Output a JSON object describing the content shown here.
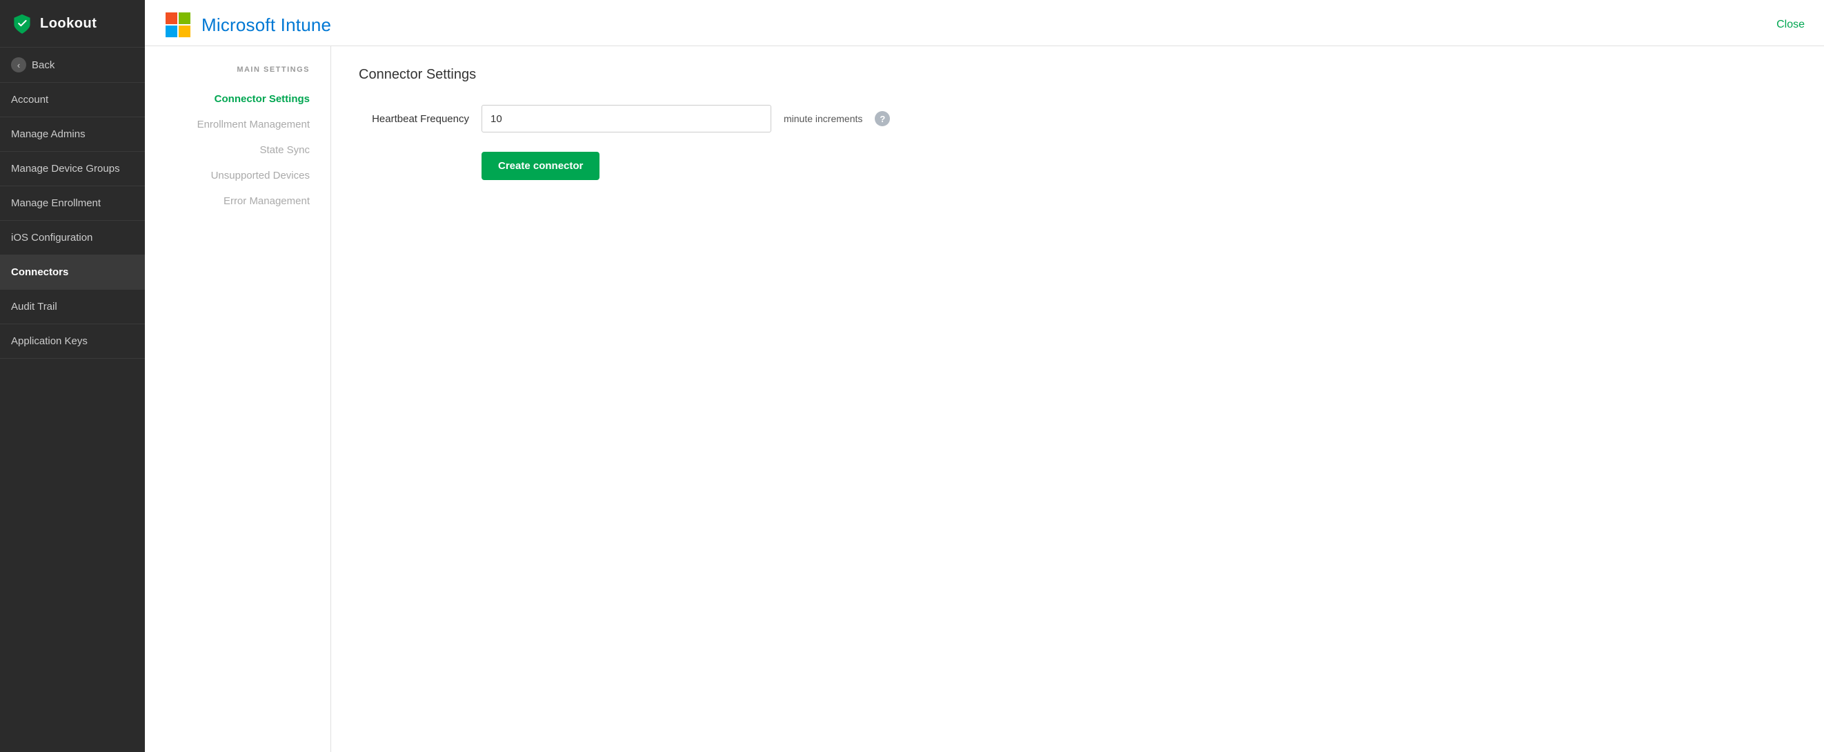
{
  "sidebar": {
    "logo_text": "Lookout",
    "back_label": "Back",
    "items": [
      {
        "id": "account",
        "label": "Account",
        "active": false
      },
      {
        "id": "manage-admins",
        "label": "Manage Admins",
        "active": false
      },
      {
        "id": "manage-device-groups",
        "label": "Manage Device Groups",
        "active": false
      },
      {
        "id": "manage-enrollment",
        "label": "Manage Enrollment",
        "active": false
      },
      {
        "id": "ios-configuration",
        "label": "iOS Configuration",
        "active": false
      },
      {
        "id": "connectors",
        "label": "Connectors",
        "active": true
      },
      {
        "id": "audit-trail",
        "label": "Audit Trail",
        "active": false
      },
      {
        "id": "application-keys",
        "label": "Application Keys",
        "active": false
      }
    ]
  },
  "topbar": {
    "title": "Microsoft Intune",
    "close_label": "Close"
  },
  "main_settings": {
    "section_title": "MAIN SETTINGS",
    "nav_items": [
      {
        "id": "connector-settings",
        "label": "Connector Settings",
        "active": true
      },
      {
        "id": "enrollment-management",
        "label": "Enrollment Management",
        "active": false
      },
      {
        "id": "state-sync",
        "label": "State Sync",
        "active": false
      },
      {
        "id": "unsupported-devices",
        "label": "Unsupported Devices",
        "active": false
      },
      {
        "id": "error-management",
        "label": "Error Management",
        "active": false
      }
    ]
  },
  "connector_settings": {
    "title": "Connector Settings",
    "heartbeat_label": "Heartbeat Frequency",
    "heartbeat_value": "10",
    "unit_label": "minute increments",
    "create_btn_label": "Create connector"
  },
  "icons": {
    "shield": "shield-icon",
    "back_chevron": "chevron-left-icon",
    "help": "help-icon",
    "ms_logo": "microsoft-logo-icon"
  }
}
